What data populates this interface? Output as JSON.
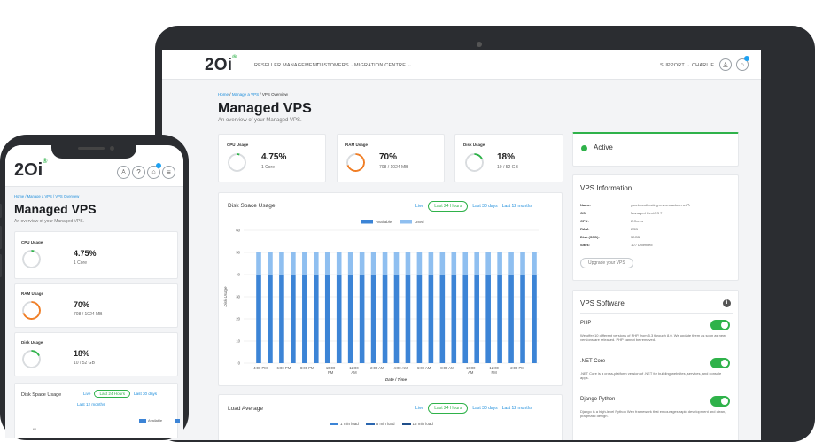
{
  "brand": {
    "logo": "2Oi",
    "logo_mark": "®"
  },
  "laptop": {
    "nav": {
      "items": [
        "RESELLER MANAGEMENT ⌄",
        "CUSTOMERS ⌄",
        "MIGRATION CENTRE ⌄"
      ],
      "support": "SUPPORT ⌄",
      "user": "CHARLIE"
    },
    "breadcrumb": {
      "home": "Home",
      "sep1": "/",
      "manage": "Manage a VPS",
      "sep2": "/",
      "current": "VPS Overview"
    },
    "title": "Managed VPS",
    "subtitle": "An overview of your Managed VPS.",
    "stats": [
      {
        "label": "CPU Usage",
        "value": "4.75%",
        "sub": "1 Core",
        "percent": 4.75,
        "color": "#2fb24a"
      },
      {
        "label": "RAM Usage",
        "value": "70%",
        "sub": "708 / 1024 MB",
        "percent": 70,
        "color": "#f07e26"
      },
      {
        "label": "Disk Usage",
        "value": "18%",
        "sub": "10 / 52 GB",
        "percent": 18,
        "color": "#2fb24a"
      }
    ],
    "status": {
      "label": "Active",
      "color": "#2fb24a"
    },
    "disk_chart": {
      "title": "Disk Space Usage",
      "ranges": [
        "Live",
        "Last 24 Hours",
        "Last 30 days",
        "Last 12 months"
      ],
      "active_range": "Last 24 Hours"
    },
    "load_chart": {
      "title": "Load Average",
      "ranges": [
        "Live",
        "Last 24 Hours",
        "Last 30 days",
        "Last 12 months"
      ],
      "legend": [
        "1 min load",
        "5 min load",
        "15 min load"
      ]
    },
    "vps_info": {
      "title": "VPS Information",
      "rows": [
        {
          "k": "Name:",
          "v": "yourbrandhosting.mvps.stackcp.net ✎"
        },
        {
          "k": "OS:",
          "v": "Managed CentOS 7"
        },
        {
          "k": "CPU:",
          "v": "2 Cores"
        },
        {
          "k": "RAM:",
          "v": "2GB"
        },
        {
          "k": "Disk (SSD):",
          "v": "50GB"
        },
        {
          "k": "Sites:",
          "v": "10 / Unlimited"
        }
      ],
      "upgrade": "Upgrade your VPS"
    },
    "vps_software": {
      "title": "VPS Software",
      "info_icon": "i",
      "items": [
        {
          "name": "PHP",
          "desc": "We offer 10 different versions of PHP, from 5.3 through 8.0. We update them as soon as new versions are released. PHP cannot be removed.",
          "on": true
        },
        {
          "name": ".NET Core",
          "desc": ".NET Core is a cross-platform version of .NET for building websites, services, and console apps.",
          "on": true
        },
        {
          "name": "Django Python",
          "desc": "Django is a high-level Python Web framework that encourages rapid development and clean, pragmatic design.",
          "on": true
        }
      ]
    }
  },
  "phone": {
    "breadcrumb": "Home / Manage a VPS / VPS Overview",
    "title": "Managed VPS",
    "subtitle": "An overview of your Managed VPS.",
    "stats": [
      {
        "label": "CPU Usage",
        "value": "4.75%",
        "sub": "1 Core"
      },
      {
        "label": "RAM Usage",
        "value": "70%",
        "sub": "708 / 1024 MB"
      },
      {
        "label": "Disk Usage",
        "value": "18%",
        "sub": "10 / 52 GB"
      }
    ],
    "disk_title": "Disk Space Usage",
    "ranges": [
      "Live",
      "Last 24 Hours",
      "Last 30 days",
      "Last 12 months"
    ],
    "legend_available": "Available",
    "y_first": "60"
  },
  "chart_data": {
    "type": "bar",
    "title": "",
    "xlabel": "Date / Time",
    "ylabel": "Disk Usage",
    "ylim": [
      0,
      60
    ],
    "yticks": [
      0,
      10,
      20,
      30,
      40,
      50,
      60
    ],
    "xticks": [
      "4:00 PM",
      "6:00 PM",
      "8:00 PM",
      "10:00 PM",
      "12:00 AM",
      "2:00 AM",
      "4:00 AM",
      "6:00 AM",
      "8:00 AM",
      "10:00 AM",
      "12:00 PM",
      "2:00 PM"
    ],
    "legend_position": "top-center",
    "grid": true,
    "stacked": true,
    "bar_count": 25,
    "series": [
      {
        "name": "Available",
        "value": 40,
        "color": "#3c84d6"
      },
      {
        "name": "Used",
        "value": 10,
        "color": "#8fbff0"
      }
    ]
  }
}
